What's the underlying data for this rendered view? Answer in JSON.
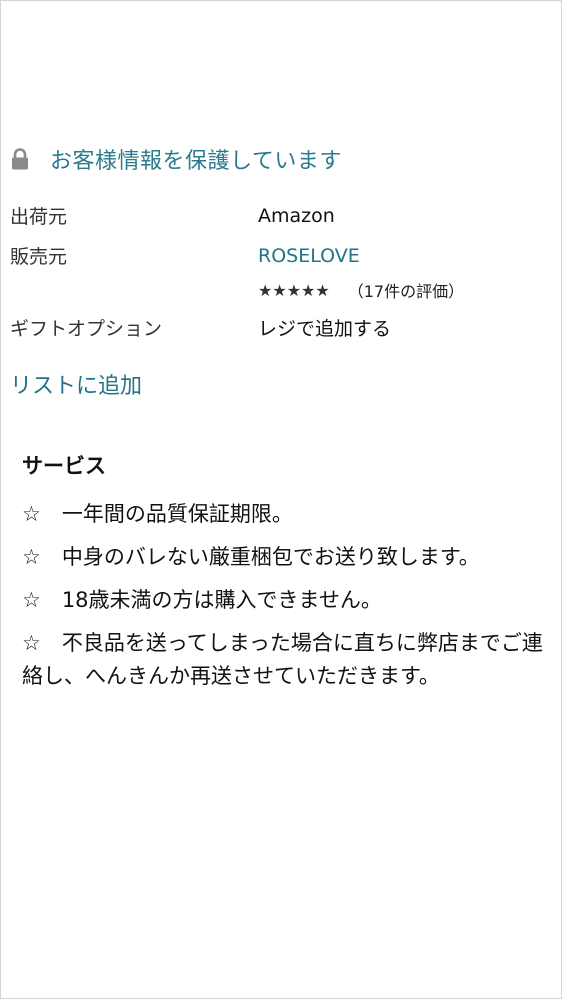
{
  "security": {
    "icon": "lock-icon",
    "text": "お客様情報を保護しています"
  },
  "info": {
    "ships_from_label": "出荷元",
    "ships_from_value": "Amazon",
    "sold_by_label": "販売元",
    "sold_by_value": "ROSELOVE",
    "rating_stars": "★★★★★",
    "rating_value": 5,
    "rating_count_text": "（17件の評価）",
    "gift_label": "ギフトオプション",
    "gift_value": "レジで追加する"
  },
  "add_to_list": "リストに追加",
  "service": {
    "title": "サービス",
    "items": [
      "☆　一年間の品質保証期限。",
      "☆　中身のバレない厳重梱包でお送り致します。",
      "☆　18歳未満の方は購入できません。",
      "☆　不良品を送ってしまった場合に直ちに弊店までご連絡し、へんきんか再送させていただきます。"
    ]
  },
  "colors": {
    "link": "#1f7587",
    "secure_text": "#2a7c8e",
    "lock": "#8a8a8a"
  }
}
